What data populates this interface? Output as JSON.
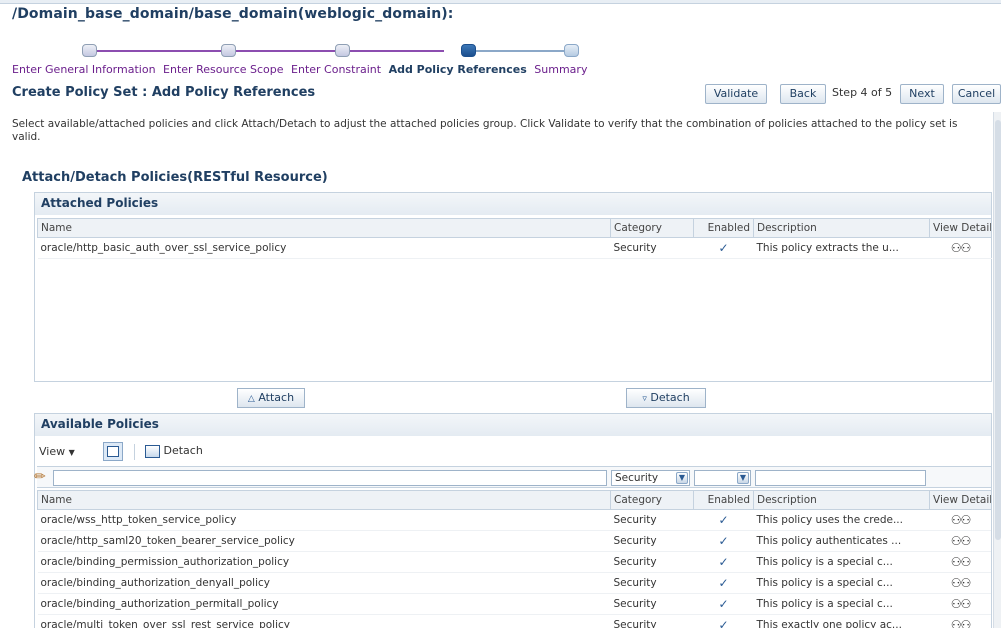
{
  "header": {
    "domain_title": "/Domain_base_domain/base_domain(weblogic_domain):"
  },
  "train": {
    "steps": [
      {
        "label": "Enter General Information",
        "state": "visited"
      },
      {
        "label": "Enter Resource Scope",
        "state": "visited"
      },
      {
        "label": "Enter Constraint",
        "state": "visited"
      },
      {
        "label": "Add Policy References",
        "state": "current"
      },
      {
        "label": "Summary",
        "state": "future"
      }
    ]
  },
  "page": {
    "title": "Create Policy Set : Add Policy References",
    "validate_label": "Validate",
    "back_label": "Back",
    "step_text": "Step 4 of 5",
    "next_label": "Next",
    "cancel_label": "Cancel",
    "instructions": "Select available/attached policies and click Attach/Detach to adjust the attached policies group. Click Validate to verify that the combination of policies attached to the policy set is valid."
  },
  "section": {
    "title": "Attach/Detach Policies(RESTful Resource)"
  },
  "attached": {
    "header": "Attached Policies",
    "columns": {
      "name": "Name",
      "category": "Category",
      "enabled": "Enabled",
      "description": "Description",
      "view": "View Detail"
    },
    "rows": [
      {
        "name": "oracle/http_basic_auth_over_ssl_service_policy",
        "category": "Security",
        "enabled": "✓",
        "description": "This policy extracts the u..."
      }
    ]
  },
  "actions": {
    "attach_label": "Attach",
    "detach_label": "Detach"
  },
  "available": {
    "header": "Available Policies",
    "toolbar": {
      "view_label": "View",
      "detach_label": "Detach"
    },
    "filter": {
      "category_value": "Security",
      "enabled_value": ""
    },
    "columns": {
      "name": "Name",
      "category": "Category",
      "enabled": "Enabled",
      "description": "Description",
      "view": "View Detail"
    },
    "rows": [
      {
        "name": "oracle/wss_http_token_service_policy",
        "category": "Security",
        "enabled": "✓",
        "description": "This policy uses the crede..."
      },
      {
        "name": "oracle/http_saml20_token_bearer_service_policy",
        "category": "Security",
        "enabled": "✓",
        "description": "This policy authenticates ..."
      },
      {
        "name": "oracle/binding_permission_authorization_policy",
        "category": "Security",
        "enabled": "✓",
        "description": "This policy is a special c..."
      },
      {
        "name": "oracle/binding_authorization_denyall_policy",
        "category": "Security",
        "enabled": "✓",
        "description": "This policy is a special c..."
      },
      {
        "name": "oracle/binding_authorization_permitall_policy",
        "category": "Security",
        "enabled": "✓",
        "description": "This policy is a special c..."
      },
      {
        "name": "oracle/multi_token_over_ssl_rest_service_policy",
        "category": "Security",
        "enabled": "✓",
        "description": "This exactly one policy ac..."
      }
    ]
  },
  "icons": {
    "view_detail": "glasses-icon",
    "enabled": "checkmark-icon",
    "attach": "triangle-up-icon",
    "detach": "triangle-down-icon",
    "filter_clear": "pencil-eraser-icon"
  },
  "colors": {
    "title": "#203f62",
    "train_visited": "#6b1f8c",
    "train_current": "#1b4f8e",
    "check": "#2a5a93"
  }
}
